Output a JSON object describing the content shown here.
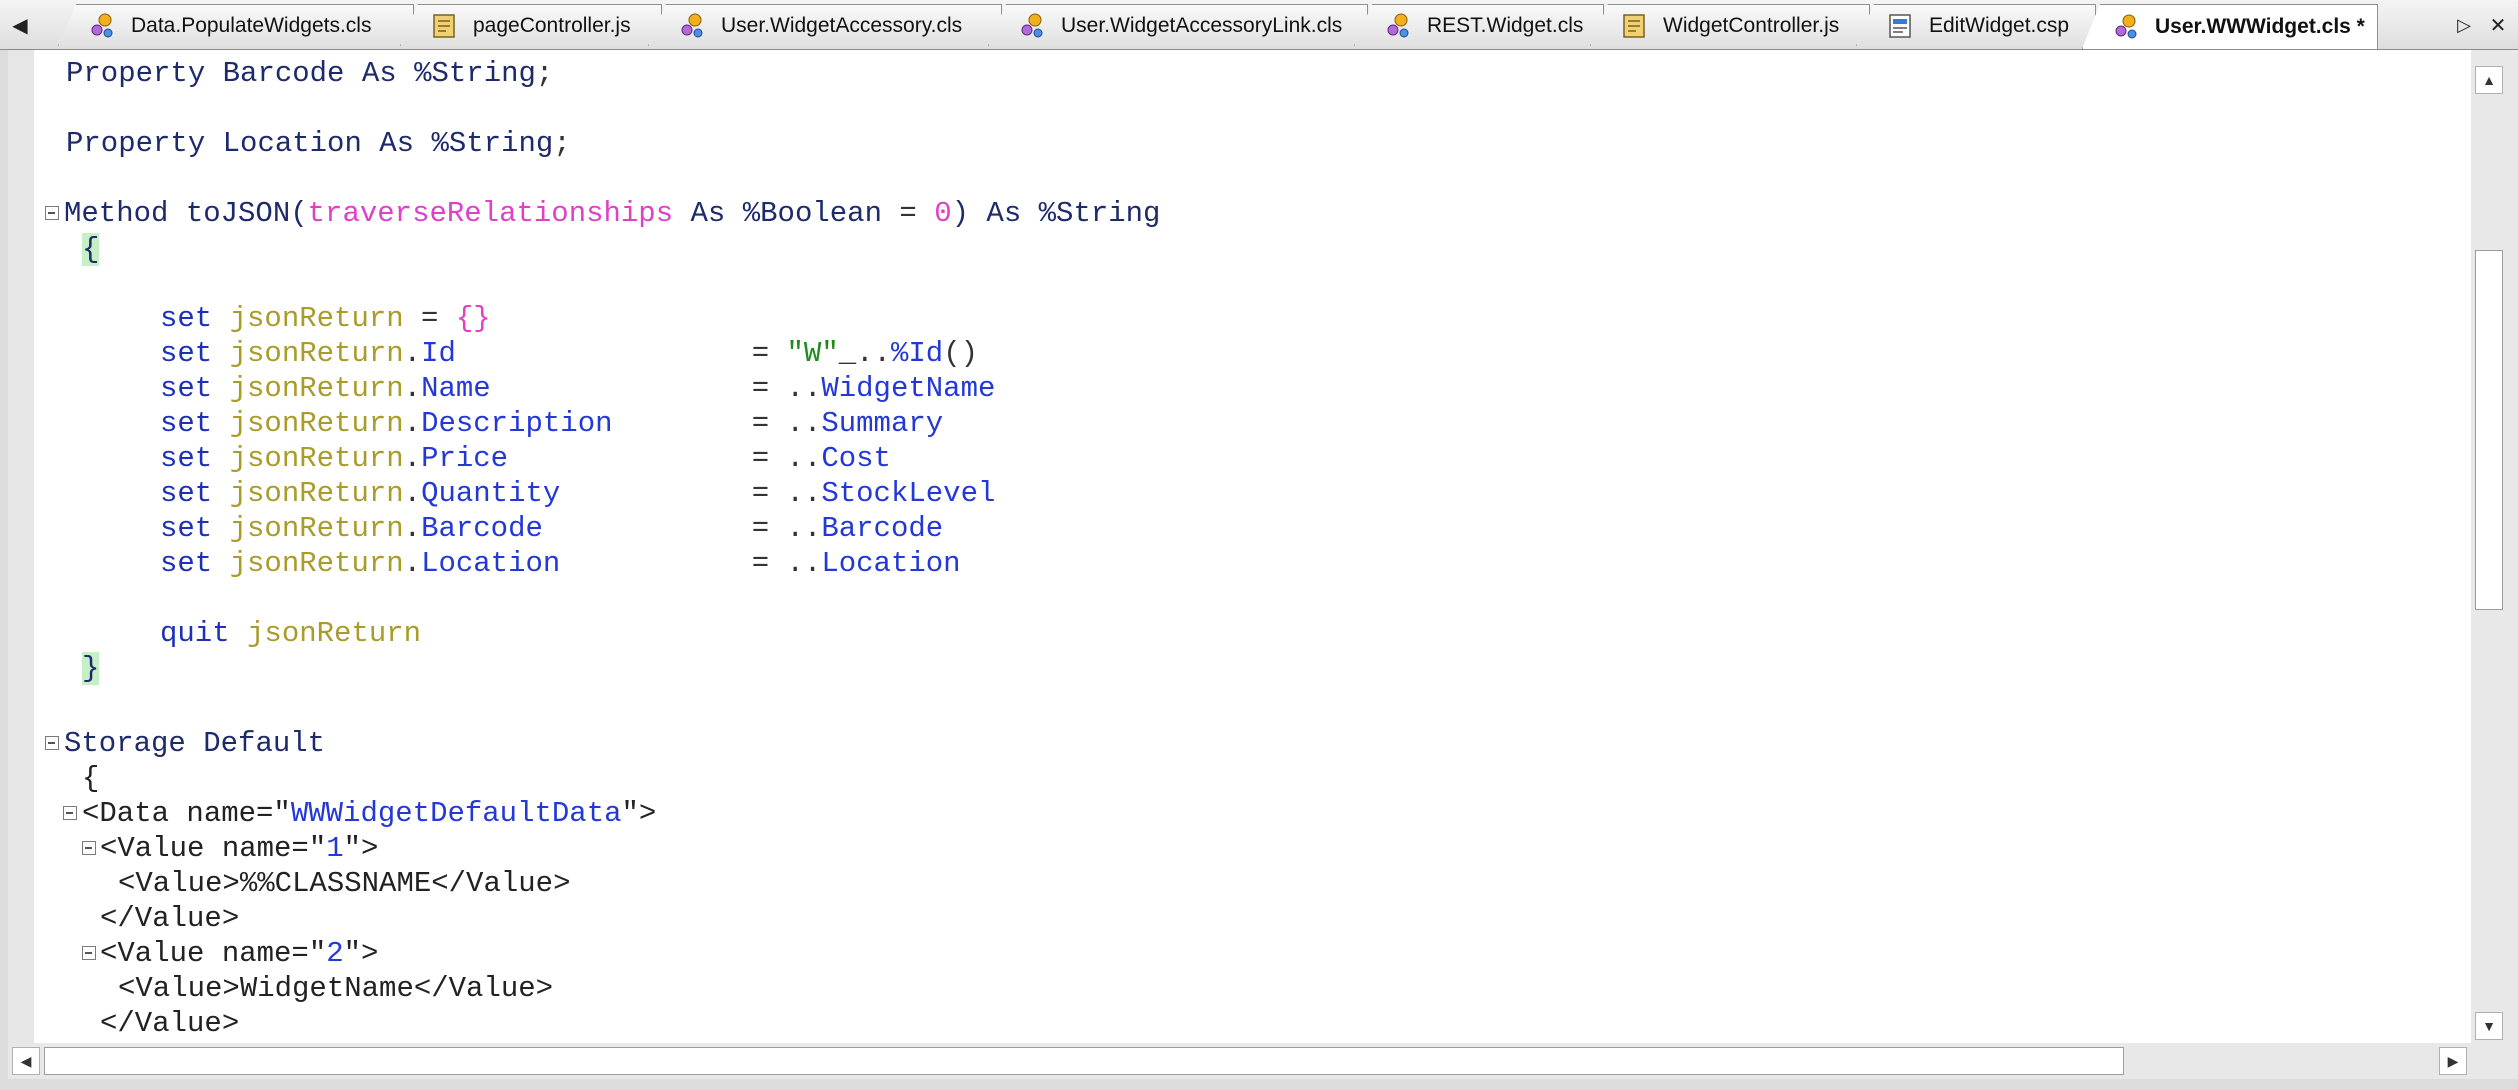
{
  "tabs": [
    {
      "label": "Data.PopulateWidgets.cls",
      "icon": "class-icon",
      "active": false
    },
    {
      "label": "pageController.js",
      "icon": "script-icon",
      "active": false
    },
    {
      "label": "User.WidgetAccessory.cls",
      "icon": "class-icon",
      "active": false
    },
    {
      "label": "User.WidgetAccessoryLink.cls",
      "icon": "class-icon",
      "active": false
    },
    {
      "label": "REST.Widget.cls",
      "icon": "class-icon",
      "active": false
    },
    {
      "label": "WidgetController.js",
      "icon": "script-icon",
      "active": false
    },
    {
      "label": "EditWidget.csp",
      "icon": "csp-page-icon",
      "active": false
    },
    {
      "label": "User.WWWidget.cls *",
      "icon": "class-icon",
      "active": true
    }
  ],
  "tab_scroll": {
    "left": "◀",
    "right": "▷",
    "close": "✕"
  },
  "code_lines": {
    "l1": {
      "a": "Property",
      "b": " Barcode ",
      "c": "As",
      "d": " %String",
      "e": ";"
    },
    "l2": {
      "a": "Property",
      "b": " Location ",
      "c": "As",
      "d": " %String",
      "e": ";"
    },
    "l3": {
      "a": "Method",
      "b": " toJSON(",
      "c": "traverseRelationships",
      "d": " As",
      "e": " %Boolean",
      "f": " = ",
      "g": "0",
      "h": ") ",
      "i": "As",
      "j": " %String"
    },
    "l4": {
      "a": "{"
    },
    "l5": {
      "a": "set",
      "b": " jsonReturn",
      "c": " = ",
      "d": "{}"
    },
    "l6": {
      "a": "set",
      "b": " jsonReturn",
      "c": ".",
      "d": "Id",
      "e": "                 = ",
      "f": "\"W\"",
      "g": "_..",
      "h": "%Id",
      "i": "()"
    },
    "l7": {
      "a": "set",
      "b": " jsonReturn",
      "c": ".",
      "d": "Name",
      "e": "               = ..",
      "f": "WidgetName"
    },
    "l8": {
      "a": "set",
      "b": " jsonReturn",
      "c": ".",
      "d": "Description",
      "e": "        = ..",
      "f": "Summary"
    },
    "l9": {
      "a": "set",
      "b": " jsonReturn",
      "c": ".",
      "d": "Price",
      "e": "              = ..",
      "f": "Cost"
    },
    "l10": {
      "a": "set",
      "b": " jsonReturn",
      "c": ".",
      "d": "Quantity",
      "e": "           = ..",
      "f": "StockLevel"
    },
    "l11": {
      "a": "set",
      "b": " jsonReturn",
      "c": ".",
      "d": "Barcode",
      "e": "            = ..",
      "f": "Barcode"
    },
    "l12": {
      "a": "set",
      "b": " jsonReturn",
      "c": ".",
      "d": "Location",
      "e": "           = ..",
      "f": "Location"
    },
    "l13": {
      "a": "quit",
      "b": " jsonReturn"
    },
    "l14": {
      "a": "}"
    },
    "l15": {
      "a": "Storage",
      "b": " Default"
    },
    "l16": {
      "a": "{"
    },
    "l17": {
      "a": "<Data name=\"",
      "b": "WWWidgetDefaultData",
      "c": "\">"
    },
    "l18": {
      "a": "<Value name=\"",
      "b": "1",
      "c": "\">"
    },
    "l19": {
      "a": "<Value>%%CLASSNAME</Value>"
    },
    "l20": {
      "a": "</Value>"
    },
    "l21": {
      "a": "<Value name=\"",
      "b": "2",
      "c": "\">"
    },
    "l22": {
      "a": "<Value>WidgetName</Value>"
    },
    "l23": {
      "a": "</Value>"
    }
  },
  "scroll": {
    "up": "▲",
    "down": "▼",
    "left": "◀",
    "right": "▶"
  },
  "colors": {
    "keyword": "#1d31b8",
    "variable": "#a99c2a",
    "parameter": "#e040c8",
    "string": "#1d8c1d",
    "member": "#2438d8",
    "brace_highlight": "#c6efc6"
  }
}
